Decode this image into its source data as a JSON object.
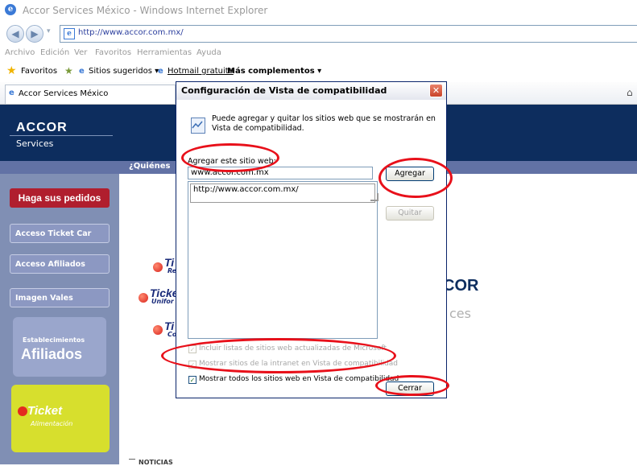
{
  "window": {
    "title": "Accor Services México - Windows Internet Explorer"
  },
  "address": {
    "url": "http://www.accor.com.mx/"
  },
  "menu": [
    "Archivo",
    "Edición",
    "Ver",
    "Favoritos",
    "Herramientas",
    "Ayuda"
  ],
  "favorites": {
    "favorites_label": "Favoritos",
    "suggested": "Sitios sugeridos ▾",
    "hotmail": "Hotmail gratuito",
    "more": "Más complementos ▾"
  },
  "tab": {
    "label": "Accor Services México"
  },
  "page": {
    "logo_main": "ACCOR",
    "logo_sub": "Services",
    "nav_item": "¿Quiénes",
    "pedidos": "Haga sus pedidos",
    "buttons": [
      "Acceso Ticket Car",
      "Acceso Afiliados",
      "Imagen Vales"
    ],
    "estab_small": "Establecimientos",
    "estab_big": "Afiliados",
    "ticket_title": "Ticket",
    "ticket_sub": "Alimentación",
    "ticket_logos": [
      {
        "main": "Ti",
        "sub": "Re"
      },
      {
        "main": "Ticke",
        "sub": "Unifor"
      },
      {
        "main": "Ti",
        "sub": "Co"
      }
    ],
    "accor_right": "COR",
    "ices": "ces",
    "noticias": "NOTICIAS"
  },
  "dialog": {
    "title": "Configuración de Vista de compatibilidad",
    "close": "✕",
    "info": "Puede agregar y quitar los sitios web que se mostrarán en Vista de compatibilidad.",
    "add_label": "Agregar este sitio web:",
    "add_value": "www.accor.com.mx",
    "list_items": [
      "http://www.accor.com.mx/"
    ],
    "btn_add": "Agregar",
    "btn_remove": "Quitar",
    "chk1": "Incluir listas de sitios web actualizadas de Microsoft",
    "chk2": "Mostrar sitios de la intranet en Vista de compatibilidad",
    "chk3": "Mostrar todos los sitios web en Vista de compatibilidad",
    "btn_close": "Cerrar"
  }
}
